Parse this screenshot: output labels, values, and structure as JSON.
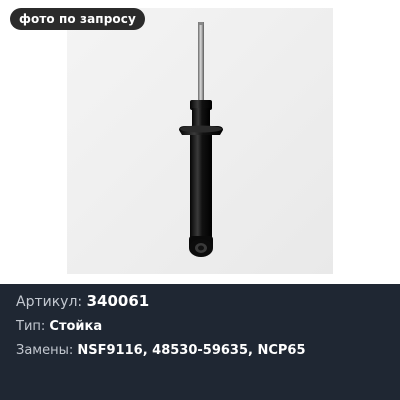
{
  "badge": {
    "text": "фото по запросу"
  },
  "product_image": {
    "icon": "shock-absorber-strut-photo"
  },
  "details": {
    "article_label": "Артикул:",
    "article_value": "340061",
    "type_label": "Тип:",
    "type_value": "Стойка",
    "replacements_label": "Замены:",
    "replacements_value": "NSF9116, 48530-59635, NCP65"
  },
  "colors": {
    "info_background": "#1f2733",
    "badge_background": "#2b2b2b",
    "label_text": "#c3c8d0",
    "value_text": "#ffffff"
  }
}
